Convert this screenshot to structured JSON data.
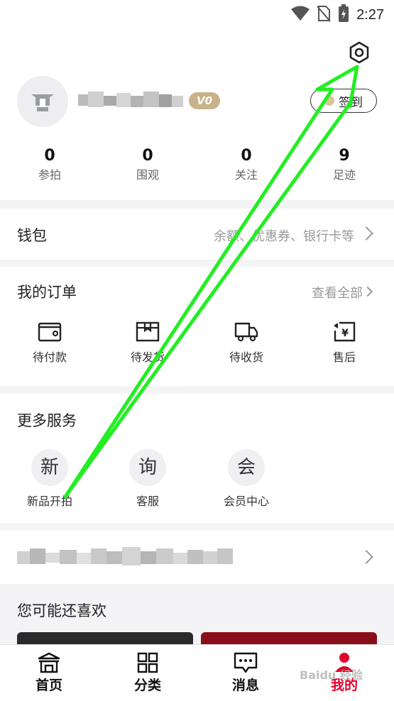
{
  "status_bar": {
    "time": "2:27",
    "icons": [
      "wifi-icon",
      "no-sim-icon",
      "battery-charging-icon"
    ]
  },
  "header": {
    "settings_icon": "gear-hex-icon",
    "level_badge": "V0",
    "checkin_label": "签到"
  },
  "stats": [
    {
      "value": "0",
      "label": "参拍"
    },
    {
      "value": "0",
      "label": "围观"
    },
    {
      "value": "0",
      "label": "关注"
    },
    {
      "value": "9",
      "label": "足迹"
    }
  ],
  "wallet": {
    "title": "钱包",
    "hint": "余额、优惠券、银行卡等"
  },
  "orders": {
    "title": "我的订单",
    "view_all": "查看全部",
    "items": [
      {
        "label": "待付款",
        "icon": "wallet-icon"
      },
      {
        "label": "待发货",
        "icon": "package-icon"
      },
      {
        "label": "待收货",
        "icon": "truck-icon"
      },
      {
        "label": "售后",
        "icon": "refund-icon"
      }
    ]
  },
  "services": {
    "title": "更多服务",
    "items": [
      {
        "glyph": "新",
        "label": "新品开拍"
      },
      {
        "glyph": "询",
        "label": "客服"
      },
      {
        "glyph": "会",
        "label": "会员中心"
      }
    ]
  },
  "recommend": {
    "title": "您可能还喜欢"
  },
  "tab_bar": {
    "items": [
      {
        "label": "首页",
        "icon": "home-icon"
      },
      {
        "label": "分类",
        "icon": "category-grid-icon"
      },
      {
        "label": "消息",
        "icon": "message-icon"
      },
      {
        "label": "我的",
        "icon": "profile-icon",
        "active": true
      }
    ]
  },
  "watermark": "Baidu 经验",
  "colors": {
    "accent_red": "#e4002b",
    "annotation_green": "#22ee22",
    "badge_gold": "#c9b28a"
  }
}
